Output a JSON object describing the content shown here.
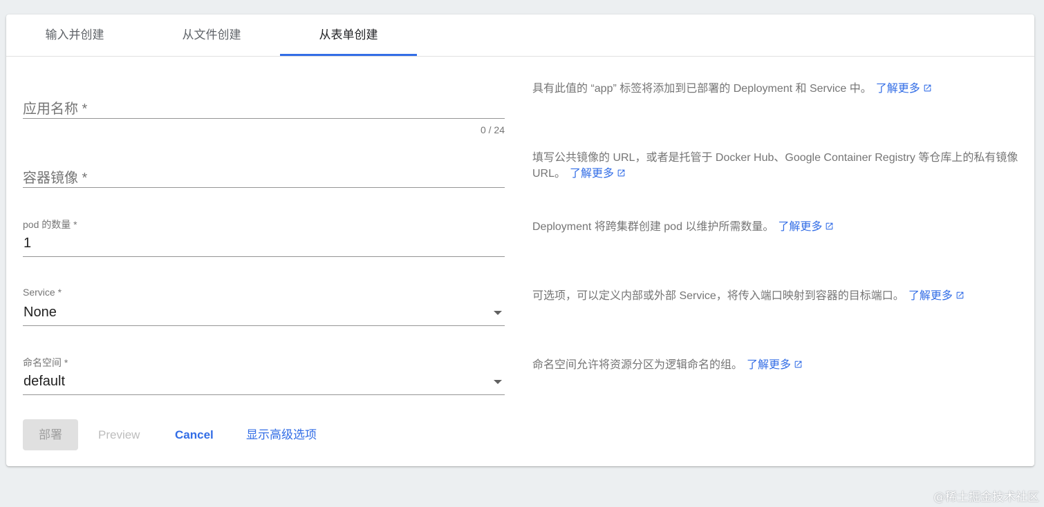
{
  "tabs": [
    {
      "label": "输入并创建",
      "active": false
    },
    {
      "label": "从文件创建",
      "active": false
    },
    {
      "label": "从表单创建",
      "active": true
    }
  ],
  "form": {
    "app_name": {
      "label": "应用名称 *",
      "value": "",
      "counter": "0 / 24"
    },
    "container_image": {
      "label": "容器镜像 *",
      "value": ""
    },
    "pod_count": {
      "label": "pod 的数量 *",
      "value": "1"
    },
    "service": {
      "label": "Service *",
      "value": "None"
    },
    "namespace": {
      "label": "命名空间 *",
      "value": "default"
    }
  },
  "help": {
    "app_name": "具有此值的 “app” 标签将添加到已部署的 Deployment 和 Service 中。",
    "container_image": "填写公共镜像的 URL，或者是托管于 Docker Hub、Google Container Registry 等仓库上的私有镜像 URL。",
    "pod_count": "Deployment 将跨集群创建 pod 以维护所需数量。",
    "service": "可选项，可以定义内部或外部 Service，将传入端口映射到容器的目标端口。",
    "namespace": "命名空间允许将资源分区为逻辑命名的组。",
    "learn_more": "了解更多"
  },
  "actions": {
    "deploy": "部署",
    "preview": "Preview",
    "cancel": "Cancel",
    "advanced": "显示高级选项"
  },
  "colors": {
    "accent": "#326de6",
    "disabled_bg": "#e0e0e0",
    "disabled_text": "#9e9e9e"
  },
  "icons": {
    "external_link": "open-in-new-icon",
    "dropdown": "arrow-drop-down-icon"
  },
  "watermark": "@稀土掘金技术社区"
}
